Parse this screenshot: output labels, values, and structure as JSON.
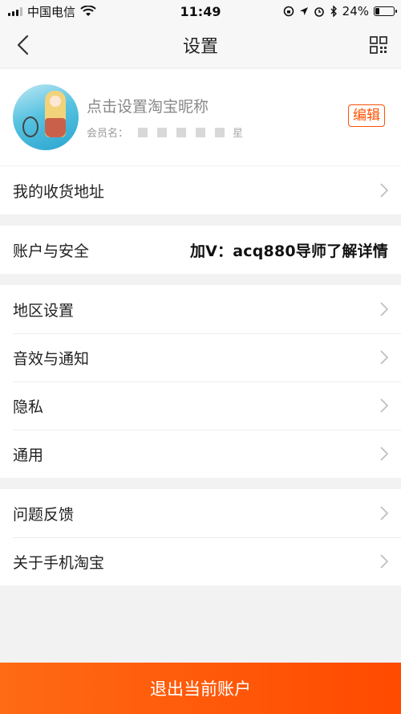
{
  "status_bar": {
    "carrier": "中国电信",
    "time": "11:49",
    "battery_percent": "24%",
    "battery_level": 0.24
  },
  "nav": {
    "title": "设置",
    "back_icon": "chevron-left-icon",
    "scan_icon": "qr-scan-icon"
  },
  "profile": {
    "nickname_prompt": "点击设置淘宝昵称",
    "member_label": "会员名：",
    "member_suffix": "星",
    "edit_label": "编辑"
  },
  "rows": {
    "address": "我的收货地址",
    "account_security": "账户与安全",
    "promo_text": "加V：acq880导师了解详情",
    "region": "地区设置",
    "sound_notify": "音效与通知",
    "privacy": "隐私",
    "general": "通用",
    "feedback": "问题反馈",
    "about": "关于手机淘宝"
  },
  "logout_label": "退出当前账户",
  "colors": {
    "accent": "#ff5000",
    "logout_start": "#ff6a14",
    "logout_end": "#ff4a00",
    "background": "#f2f2f2"
  }
}
